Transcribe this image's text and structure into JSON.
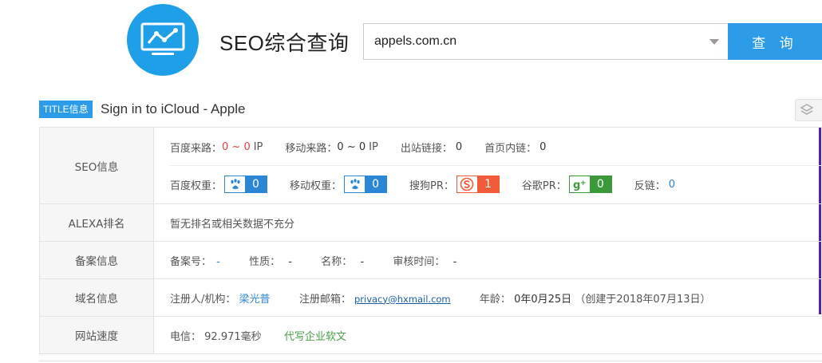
{
  "header": {
    "brand": "SEO综合查询",
    "search_value": "appels.com.cn",
    "query_button": "查 询"
  },
  "title_section": {
    "badge": "TITLE信息",
    "text": "Sign in to iCloud - Apple"
  },
  "colors": {
    "accent": "#2c9ce8",
    "red": "#e64340",
    "green": "#4aa04a",
    "purple": "#5a1fa6"
  },
  "rows": {
    "seo": {
      "head": "SEO信息",
      "baidu_source_label": "百度来路：",
      "baidu_source_value": "0 ~ 0",
      "baidu_source_unit": "IP",
      "mobile_source_label": "移动来路：",
      "mobile_source_value": "0 ~ 0",
      "mobile_source_unit": "IP",
      "outbound_label": "出站链接：",
      "outbound_value": "0",
      "home_inner_label": "首页内链：",
      "home_inner_value": "0",
      "baidu_weight_label": "百度权重：",
      "baidu_weight_value": "0",
      "mobile_weight_label": "移动权重：",
      "mobile_weight_value": "0",
      "sogou_pr_label": "搜狗PR：",
      "sogou_pr_value": "1",
      "google_pr_label": "谷歌PR：",
      "google_pr_value": "0",
      "backlink_label": "反链：",
      "backlink_value": "0"
    },
    "alexa": {
      "head": "ALEXA排名",
      "text": "暂无排名或相关数据不充分"
    },
    "icp": {
      "head": "备案信息",
      "number_label": "备案号：",
      "number_value": "-",
      "nature_label": "性质：",
      "nature_value": "-",
      "name_label": "名称：",
      "name_value": "-",
      "audit_label": "审核时间：",
      "audit_value": "-"
    },
    "domain": {
      "head": "域名信息",
      "registrant_label": "注册人/机构：",
      "registrant_value": "梁光普",
      "email_label": "注册邮箱：",
      "email_value": "privacy@hxmail.com",
      "age_label": "年龄：",
      "age_value": "0年0月25日",
      "created": "（创建于2018年07月13日）"
    },
    "speed": {
      "head": "网站速度",
      "telecom_label": "电信：",
      "telecom_value": "92.971毫秒",
      "ad_link": "代写企业软文"
    }
  }
}
